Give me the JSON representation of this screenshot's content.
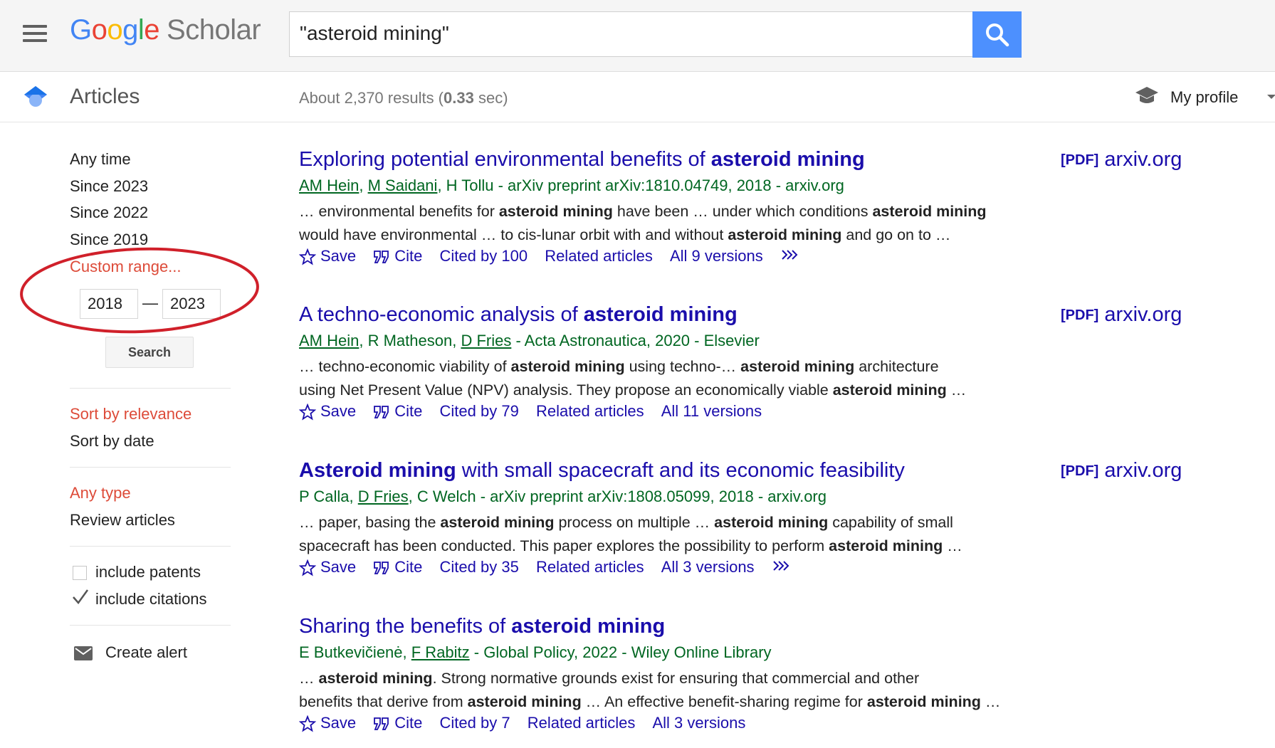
{
  "header": {
    "logo": {
      "g": "G",
      "o1": "o",
      "o2": "o",
      "g2": "g",
      "l": "l",
      "e": "e",
      "product": "Scholar"
    },
    "search_query": "\"asteroid mining\""
  },
  "subheader": {
    "section_title": "Articles",
    "stats_prefix": "About 2,370 results (",
    "stats_time": "0.33",
    "stats_suffix": " sec)",
    "profile_label": "My profile"
  },
  "sidebar": {
    "time_filters": [
      "Any time",
      "Since 2023",
      "Since 2022",
      "Since 2019"
    ],
    "custom_range_label": "Custom range...",
    "range_from": "2018",
    "range_dash": "—",
    "range_to": "2023",
    "range_search_button": "Search",
    "sort_options": [
      "Sort by relevance",
      "Sort by date"
    ],
    "type_options": [
      "Any type",
      "Review articles"
    ],
    "include_patents_label": "include patents",
    "include_patents_checked": false,
    "include_citations_label": "include citations",
    "include_citations_checked": true,
    "create_alert_label": "Create alert",
    "highlight_color": "#dd4b39",
    "annotation_color": "#d0202a"
  },
  "results": [
    {
      "title_pre": "Exploring potential environmental benefits of ",
      "title_bold": "asteroid mining",
      "title_post": "",
      "authors_linked": [
        "AM Hein",
        "M Saidani"
      ],
      "authors_rest": ", H Tollu - arXiv preprint arXiv:1810.04749, 2018 - arxiv.org",
      "snippet_line1": [
        "… environmental benefits for ",
        "asteroid mining",
        " have been … under which conditions ",
        "asteroid mining",
        ""
      ],
      "snippet_line2": [
        "would have environmental … to cis-lunar orbit with and without ",
        "asteroid mining",
        " and go on to …"
      ],
      "save": "Save",
      "cite": "Cite",
      "cited_by": "Cited by 100",
      "related": "Related articles",
      "versions": "All 9 versions",
      "has_more": true,
      "pdf_tag": "[PDF]",
      "pdf_source": "arxiv.org"
    },
    {
      "title_pre": "A techno-economic analysis of ",
      "title_bold": "asteroid mining",
      "title_post": "",
      "authors": [
        "AM Hein",
        ", R Matheson, ",
        "D Fries",
        " - Acta Astronautica, 2020 - Elsevier"
      ],
      "snippet_line1": [
        "… techno-economic viability of ",
        "asteroid mining",
        " using techno-… ",
        "asteroid mining",
        " architecture"
      ],
      "snippet_line2": [
        "using Net Present Value (NPV) analysis. They propose an economically viable ",
        "asteroid mining",
        " …"
      ],
      "save": "Save",
      "cite": "Cite",
      "cited_by": "Cited by 79",
      "related": "Related articles",
      "versions": "All 11 versions",
      "has_more": false,
      "pdf_tag": "[PDF]",
      "pdf_source": "arxiv.org"
    },
    {
      "title_pre": "",
      "title_bold": "Asteroid mining",
      "title_post": " with small spacecraft and its economic feasibility",
      "authors": [
        "P Calla, ",
        "D Fries",
        ", C Welch - arXiv preprint arXiv:1808.05099, 2018 - arxiv.org"
      ],
      "snippet_line1": [
        "… paper, basing the ",
        "asteroid mining",
        " process on multiple … ",
        "asteroid mining",
        " capability of small"
      ],
      "snippet_line2": [
        "spacecraft has been conducted. This paper explores the possibility to perform ",
        "asteroid mining",
        " …"
      ],
      "save": "Save",
      "cite": "Cite",
      "cited_by": "Cited by 35",
      "related": "Related articles",
      "versions": "All 3 versions",
      "has_more": true,
      "pdf_tag": "[PDF]",
      "pdf_source": "arxiv.org"
    },
    {
      "title_pre": "Sharing the benefits of ",
      "title_bold": "asteroid mining",
      "title_post": "",
      "authors": [
        "E Butkevičienė, ",
        "F Rabitz",
        " - Global Policy, 2022 - Wiley Online Library"
      ],
      "snippet_line1": [
        "… ",
        "asteroid mining",
        ". Strong normative grounds exist for ensuring that commercial and other",
        "",
        ""
      ],
      "snippet_line2": [
        "benefits that derive from ",
        "asteroid mining",
        " … An effective benefit-sharing regime for ",
        "asteroid mining",
        " …"
      ],
      "save": "Save",
      "cite": "Cite",
      "cited_by": "Cited by 7",
      "related": "Related articles",
      "versions": "All 3 versions",
      "has_more": false
    }
  ]
}
